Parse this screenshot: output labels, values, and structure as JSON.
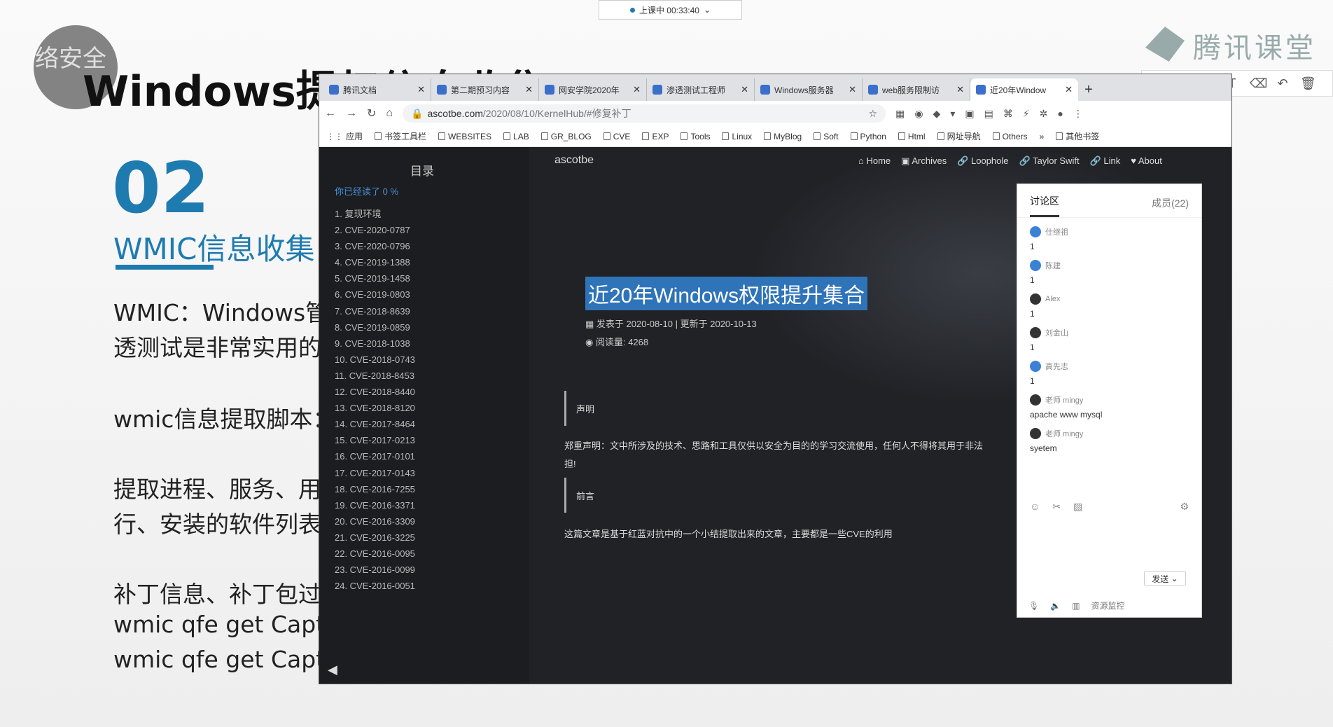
{
  "slide": {
    "logo_text": "络安全",
    "title": "Windows提权信息收集",
    "number": "02",
    "subtitle": "WMIC信息收集",
    "lines": [
      "WMIC：Windows管",
      "透测试是非常实用的",
      "wmic信息提取脚本：",
      "提取进程、服务、用",
      "行、安装的软件列表",
      "补丁信息、补丁包过",
      "wmic qfe get Capti",
      "wmic qfe get Capti"
    ],
    "brand": "腾讯课堂"
  },
  "class_bar": {
    "status": "上课中 00:33:40"
  },
  "browser": {
    "tabs": [
      {
        "title": "腾讯文档"
      },
      {
        "title": "第二期预习内容"
      },
      {
        "title": "网安学院2020年"
      },
      {
        "title": "渗透测试工程师"
      },
      {
        "title": "Windows服务器"
      },
      {
        "title": "web服务限制访"
      },
      {
        "title": "近20年Window"
      }
    ],
    "url_host": "ascotbe.com",
    "url_path": "/2020/08/10/KernelHub/#修复补丁",
    "bookmarks": [
      "应用",
      "书签工具栏",
      "WEBSITES",
      "LAB",
      "GR_BLOG",
      "CVE",
      "EXP",
      "Tools",
      "Linux",
      "MyBlog",
      "Soft",
      "Python",
      "Html",
      "网址导航",
      "Others",
      "其他书签"
    ],
    "toc": {
      "title": "目录",
      "progress": "你已经读了 0 %",
      "items": [
        "1. 复现环境",
        "2. CVE-2020-0787",
        "3. CVE-2020-0796",
        "4. CVE-2019-1388",
        "5. CVE-2019-1458",
        "6. CVE-2019-0803",
        "7. CVE-2018-8639",
        "8. CVE-2019-0859",
        "9. CVE-2018-1038",
        "10. CVE-2018-0743",
        "11. CVE-2018-8453",
        "12. CVE-2018-8440",
        "13. CVE-2018-8120",
        "14. CVE-2017-8464",
        "15. CVE-2017-0213",
        "16. CVE-2017-0101",
        "17. CVE-2017-0143",
        "18. CVE-2016-7255",
        "19. CVE-2016-3371",
        "20. CVE-2016-3309",
        "21. CVE-2016-3225",
        "22. CVE-2016-0095",
        "23. CVE-2016-0099",
        "24. CVE-2016-0051"
      ]
    },
    "blog_name": "ascotbe",
    "nav": [
      "Home",
      "Archives",
      "Loophole",
      "Taylor Swift",
      "Link",
      "About"
    ],
    "post": {
      "title": "近20年Windows权限提升集合",
      "meta": "发表于 2020-08-10 | 更新于 2020-10-13",
      "views": "阅读量: 4268",
      "block1": "声明",
      "statement": "郑重声明：文中所涉及的技术、思路和工具仅供以安全为目的的学习交流使用，任何人不得将其用于非法",
      "statement2": "担!",
      "block2": "前言",
      "intro": "这篇文章是基于红蓝对抗中的一个小结提取出来的文章，主要都是一些CVE的利用"
    }
  },
  "chat": {
    "tab_discuss": "讨论区",
    "tab_members": "成员(22)",
    "messages": [
      {
        "user": "仕继祖",
        "text": "1",
        "dark": false
      },
      {
        "user": "陈建",
        "text": "1",
        "dark": false
      },
      {
        "user": "Alex",
        "text": "1",
        "dark": true
      },
      {
        "user": "刘金山",
        "text": "1",
        "dark": true
      },
      {
        "user": "高先志",
        "text": "1",
        "dark": false
      },
      {
        "user": "老师 mingy",
        "text": "apache www mysql",
        "dark": true
      },
      {
        "user": "老师 mingy",
        "text": "syetem",
        "dark": true
      }
    ],
    "send": "发送",
    "monitor": "资源监控"
  }
}
